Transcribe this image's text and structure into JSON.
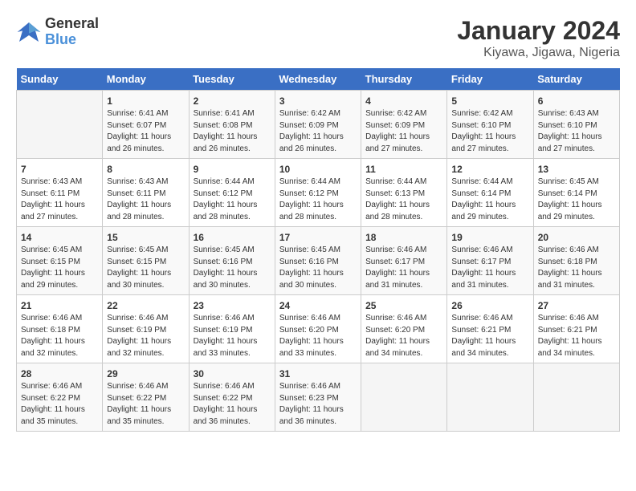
{
  "logo": {
    "line1": "General",
    "line2": "Blue"
  },
  "title": "January 2024",
  "subtitle": "Kiyawa, Jigawa, Nigeria",
  "headers": [
    "Sunday",
    "Monday",
    "Tuesday",
    "Wednesday",
    "Thursday",
    "Friday",
    "Saturday"
  ],
  "weeks": [
    [
      {
        "day": "",
        "sunrise": "",
        "sunset": "",
        "daylight": ""
      },
      {
        "day": "1",
        "sunrise": "Sunrise: 6:41 AM",
        "sunset": "Sunset: 6:07 PM",
        "daylight": "Daylight: 11 hours and 26 minutes."
      },
      {
        "day": "2",
        "sunrise": "Sunrise: 6:41 AM",
        "sunset": "Sunset: 6:08 PM",
        "daylight": "Daylight: 11 hours and 26 minutes."
      },
      {
        "day": "3",
        "sunrise": "Sunrise: 6:42 AM",
        "sunset": "Sunset: 6:09 PM",
        "daylight": "Daylight: 11 hours and 26 minutes."
      },
      {
        "day": "4",
        "sunrise": "Sunrise: 6:42 AM",
        "sunset": "Sunset: 6:09 PM",
        "daylight": "Daylight: 11 hours and 27 minutes."
      },
      {
        "day": "5",
        "sunrise": "Sunrise: 6:42 AM",
        "sunset": "Sunset: 6:10 PM",
        "daylight": "Daylight: 11 hours and 27 minutes."
      },
      {
        "day": "6",
        "sunrise": "Sunrise: 6:43 AM",
        "sunset": "Sunset: 6:10 PM",
        "daylight": "Daylight: 11 hours and 27 minutes."
      }
    ],
    [
      {
        "day": "7",
        "sunrise": "Sunrise: 6:43 AM",
        "sunset": "Sunset: 6:11 PM",
        "daylight": "Daylight: 11 hours and 27 minutes."
      },
      {
        "day": "8",
        "sunrise": "Sunrise: 6:43 AM",
        "sunset": "Sunset: 6:11 PM",
        "daylight": "Daylight: 11 hours and 28 minutes."
      },
      {
        "day": "9",
        "sunrise": "Sunrise: 6:44 AM",
        "sunset": "Sunset: 6:12 PM",
        "daylight": "Daylight: 11 hours and 28 minutes."
      },
      {
        "day": "10",
        "sunrise": "Sunrise: 6:44 AM",
        "sunset": "Sunset: 6:12 PM",
        "daylight": "Daylight: 11 hours and 28 minutes."
      },
      {
        "day": "11",
        "sunrise": "Sunrise: 6:44 AM",
        "sunset": "Sunset: 6:13 PM",
        "daylight": "Daylight: 11 hours and 28 minutes."
      },
      {
        "day": "12",
        "sunrise": "Sunrise: 6:44 AM",
        "sunset": "Sunset: 6:14 PM",
        "daylight": "Daylight: 11 hours and 29 minutes."
      },
      {
        "day": "13",
        "sunrise": "Sunrise: 6:45 AM",
        "sunset": "Sunset: 6:14 PM",
        "daylight": "Daylight: 11 hours and 29 minutes."
      }
    ],
    [
      {
        "day": "14",
        "sunrise": "Sunrise: 6:45 AM",
        "sunset": "Sunset: 6:15 PM",
        "daylight": "Daylight: 11 hours and 29 minutes."
      },
      {
        "day": "15",
        "sunrise": "Sunrise: 6:45 AM",
        "sunset": "Sunset: 6:15 PM",
        "daylight": "Daylight: 11 hours and 30 minutes."
      },
      {
        "day": "16",
        "sunrise": "Sunrise: 6:45 AM",
        "sunset": "Sunset: 6:16 PM",
        "daylight": "Daylight: 11 hours and 30 minutes."
      },
      {
        "day": "17",
        "sunrise": "Sunrise: 6:45 AM",
        "sunset": "Sunset: 6:16 PM",
        "daylight": "Daylight: 11 hours and 30 minutes."
      },
      {
        "day": "18",
        "sunrise": "Sunrise: 6:46 AM",
        "sunset": "Sunset: 6:17 PM",
        "daylight": "Daylight: 11 hours and 31 minutes."
      },
      {
        "day": "19",
        "sunrise": "Sunrise: 6:46 AM",
        "sunset": "Sunset: 6:17 PM",
        "daylight": "Daylight: 11 hours and 31 minutes."
      },
      {
        "day": "20",
        "sunrise": "Sunrise: 6:46 AM",
        "sunset": "Sunset: 6:18 PM",
        "daylight": "Daylight: 11 hours and 31 minutes."
      }
    ],
    [
      {
        "day": "21",
        "sunrise": "Sunrise: 6:46 AM",
        "sunset": "Sunset: 6:18 PM",
        "daylight": "Daylight: 11 hours and 32 minutes."
      },
      {
        "day": "22",
        "sunrise": "Sunrise: 6:46 AM",
        "sunset": "Sunset: 6:19 PM",
        "daylight": "Daylight: 11 hours and 32 minutes."
      },
      {
        "day": "23",
        "sunrise": "Sunrise: 6:46 AM",
        "sunset": "Sunset: 6:19 PM",
        "daylight": "Daylight: 11 hours and 33 minutes."
      },
      {
        "day": "24",
        "sunrise": "Sunrise: 6:46 AM",
        "sunset": "Sunset: 6:20 PM",
        "daylight": "Daylight: 11 hours and 33 minutes."
      },
      {
        "day": "25",
        "sunrise": "Sunrise: 6:46 AM",
        "sunset": "Sunset: 6:20 PM",
        "daylight": "Daylight: 11 hours and 34 minutes."
      },
      {
        "day": "26",
        "sunrise": "Sunrise: 6:46 AM",
        "sunset": "Sunset: 6:21 PM",
        "daylight": "Daylight: 11 hours and 34 minutes."
      },
      {
        "day": "27",
        "sunrise": "Sunrise: 6:46 AM",
        "sunset": "Sunset: 6:21 PM",
        "daylight": "Daylight: 11 hours and 34 minutes."
      }
    ],
    [
      {
        "day": "28",
        "sunrise": "Sunrise: 6:46 AM",
        "sunset": "Sunset: 6:22 PM",
        "daylight": "Daylight: 11 hours and 35 minutes."
      },
      {
        "day": "29",
        "sunrise": "Sunrise: 6:46 AM",
        "sunset": "Sunset: 6:22 PM",
        "daylight": "Daylight: 11 hours and 35 minutes."
      },
      {
        "day": "30",
        "sunrise": "Sunrise: 6:46 AM",
        "sunset": "Sunset: 6:22 PM",
        "daylight": "Daylight: 11 hours and 36 minutes."
      },
      {
        "day": "31",
        "sunrise": "Sunrise: 6:46 AM",
        "sunset": "Sunset: 6:23 PM",
        "daylight": "Daylight: 11 hours and 36 minutes."
      },
      {
        "day": "",
        "sunrise": "",
        "sunset": "",
        "daylight": ""
      },
      {
        "day": "",
        "sunrise": "",
        "sunset": "",
        "daylight": ""
      },
      {
        "day": "",
        "sunrise": "",
        "sunset": "",
        "daylight": ""
      }
    ]
  ]
}
